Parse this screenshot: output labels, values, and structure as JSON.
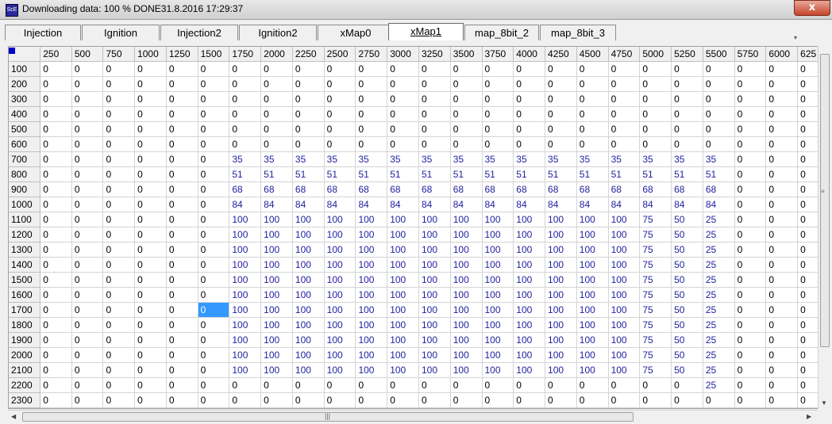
{
  "window": {
    "title": "Downloading data: 100 % DONE31.8.2016 17:29:37",
    "icon_text": "ScE",
    "close_label": "x"
  },
  "tabs": [
    {
      "label": "Injection",
      "active": false
    },
    {
      "label": "Ignition",
      "active": false
    },
    {
      "label": "Injection2",
      "active": false
    },
    {
      "label": "Ignition2",
      "active": false
    },
    {
      "label": "xMap0",
      "active": false
    },
    {
      "label": "xMap1",
      "active": true
    },
    {
      "label": "map_8bit_2",
      "active": false
    },
    {
      "label": "map_8bit_3",
      "active": false
    }
  ],
  "grid": {
    "columns": [
      "250",
      "500",
      "750",
      "1000",
      "1250",
      "1500",
      "1750",
      "2000",
      "2250",
      "2500",
      "2750",
      "3000",
      "3250",
      "3500",
      "3750",
      "4000",
      "4250",
      "4500",
      "4750",
      "5000",
      "5250",
      "5500",
      "5750",
      "6000",
      "625"
    ],
    "selected": {
      "row": "1700",
      "col": "1500"
    },
    "colors": {
      "blue": "#1f1f9f",
      "black": "#000000",
      "selected_bg": "#3399ff"
    },
    "rows": [
      {
        "label": "100",
        "values": [
          0,
          0,
          0,
          0,
          0,
          0,
          0,
          0,
          0,
          0,
          0,
          0,
          0,
          0,
          0,
          0,
          0,
          0,
          0,
          0,
          0,
          0,
          0,
          0,
          0
        ]
      },
      {
        "label": "200",
        "values": [
          0,
          0,
          0,
          0,
          0,
          0,
          0,
          0,
          0,
          0,
          0,
          0,
          0,
          0,
          0,
          0,
          0,
          0,
          0,
          0,
          0,
          0,
          0,
          0,
          0
        ]
      },
      {
        "label": "300",
        "values": [
          0,
          0,
          0,
          0,
          0,
          0,
          0,
          0,
          0,
          0,
          0,
          0,
          0,
          0,
          0,
          0,
          0,
          0,
          0,
          0,
          0,
          0,
          0,
          0,
          0
        ]
      },
      {
        "label": "400",
        "values": [
          0,
          0,
          0,
          0,
          0,
          0,
          0,
          0,
          0,
          0,
          0,
          0,
          0,
          0,
          0,
          0,
          0,
          0,
          0,
          0,
          0,
          0,
          0,
          0,
          0
        ]
      },
      {
        "label": "500",
        "values": [
          0,
          0,
          0,
          0,
          0,
          0,
          0,
          0,
          0,
          0,
          0,
          0,
          0,
          0,
          0,
          0,
          0,
          0,
          0,
          0,
          0,
          0,
          0,
          0,
          0
        ]
      },
      {
        "label": "600",
        "values": [
          0,
          0,
          0,
          0,
          0,
          0,
          0,
          0,
          0,
          0,
          0,
          0,
          0,
          0,
          0,
          0,
          0,
          0,
          0,
          0,
          0,
          0,
          0,
          0,
          0
        ]
      },
      {
        "label": "700",
        "values": [
          0,
          0,
          0,
          0,
          0,
          0,
          35,
          35,
          35,
          35,
          35,
          35,
          35,
          35,
          35,
          35,
          35,
          35,
          35,
          35,
          35,
          35,
          0,
          0,
          0
        ]
      },
      {
        "label": "800",
        "values": [
          0,
          0,
          0,
          0,
          0,
          0,
          51,
          51,
          51,
          51,
          51,
          51,
          51,
          51,
          51,
          51,
          51,
          51,
          51,
          51,
          51,
          51,
          0,
          0,
          0
        ]
      },
      {
        "label": "900",
        "values": [
          0,
          0,
          0,
          0,
          0,
          0,
          68,
          68,
          68,
          68,
          68,
          68,
          68,
          68,
          68,
          68,
          68,
          68,
          68,
          68,
          68,
          68,
          0,
          0,
          0
        ]
      },
      {
        "label": "1000",
        "values": [
          0,
          0,
          0,
          0,
          0,
          0,
          84,
          84,
          84,
          84,
          84,
          84,
          84,
          84,
          84,
          84,
          84,
          84,
          84,
          84,
          84,
          84,
          0,
          0,
          0
        ]
      },
      {
        "label": "1100",
        "values": [
          0,
          0,
          0,
          0,
          0,
          0,
          100,
          100,
          100,
          100,
          100,
          100,
          100,
          100,
          100,
          100,
          100,
          100,
          100,
          75,
          50,
          25,
          0,
          0,
          0
        ]
      },
      {
        "label": "1200",
        "values": [
          0,
          0,
          0,
          0,
          0,
          0,
          100,
          100,
          100,
          100,
          100,
          100,
          100,
          100,
          100,
          100,
          100,
          100,
          100,
          75,
          50,
          25,
          0,
          0,
          0
        ]
      },
      {
        "label": "1300",
        "values": [
          0,
          0,
          0,
          0,
          0,
          0,
          100,
          100,
          100,
          100,
          100,
          100,
          100,
          100,
          100,
          100,
          100,
          100,
          100,
          75,
          50,
          25,
          0,
          0,
          0
        ]
      },
      {
        "label": "1400",
        "values": [
          0,
          0,
          0,
          0,
          0,
          0,
          100,
          100,
          100,
          100,
          100,
          100,
          100,
          100,
          100,
          100,
          100,
          100,
          100,
          75,
          50,
          25,
          0,
          0,
          0
        ]
      },
      {
        "label": "1500",
        "values": [
          0,
          0,
          0,
          0,
          0,
          0,
          100,
          100,
          100,
          100,
          100,
          100,
          100,
          100,
          100,
          100,
          100,
          100,
          100,
          75,
          50,
          25,
          0,
          0,
          0
        ]
      },
      {
        "label": "1600",
        "values": [
          0,
          0,
          0,
          0,
          0,
          0,
          100,
          100,
          100,
          100,
          100,
          100,
          100,
          100,
          100,
          100,
          100,
          100,
          100,
          75,
          50,
          25,
          0,
          0,
          0
        ]
      },
      {
        "label": "1700",
        "values": [
          0,
          0,
          0,
          0,
          0,
          0,
          100,
          100,
          100,
          100,
          100,
          100,
          100,
          100,
          100,
          100,
          100,
          100,
          100,
          75,
          50,
          25,
          0,
          0,
          0
        ]
      },
      {
        "label": "1800",
        "values": [
          0,
          0,
          0,
          0,
          0,
          0,
          100,
          100,
          100,
          100,
          100,
          100,
          100,
          100,
          100,
          100,
          100,
          100,
          100,
          75,
          50,
          25,
          0,
          0,
          0
        ]
      },
      {
        "label": "1900",
        "values": [
          0,
          0,
          0,
          0,
          0,
          0,
          100,
          100,
          100,
          100,
          100,
          100,
          100,
          100,
          100,
          100,
          100,
          100,
          100,
          75,
          50,
          25,
          0,
          0,
          0
        ]
      },
      {
        "label": "2000",
        "values": [
          0,
          0,
          0,
          0,
          0,
          0,
          100,
          100,
          100,
          100,
          100,
          100,
          100,
          100,
          100,
          100,
          100,
          100,
          100,
          75,
          50,
          25,
          0,
          0,
          0
        ]
      },
      {
        "label": "2100",
        "values": [
          0,
          0,
          0,
          0,
          0,
          0,
          100,
          100,
          100,
          100,
          100,
          100,
          100,
          100,
          100,
          100,
          100,
          100,
          100,
          75,
          50,
          25,
          0,
          0,
          0
        ]
      },
      {
        "label": "2200",
        "values": [
          0,
          0,
          0,
          0,
          0,
          0,
          0,
          0,
          0,
          0,
          0,
          0,
          0,
          0,
          0,
          0,
          0,
          0,
          0,
          0,
          0,
          25,
          0,
          0,
          0
        ]
      },
      {
        "label": "2300",
        "values": [
          0,
          0,
          0,
          0,
          0,
          0,
          0,
          0,
          0,
          0,
          0,
          0,
          0,
          0,
          0,
          0,
          0,
          0,
          0,
          0,
          0,
          0,
          0,
          0,
          0
        ]
      }
    ]
  }
}
